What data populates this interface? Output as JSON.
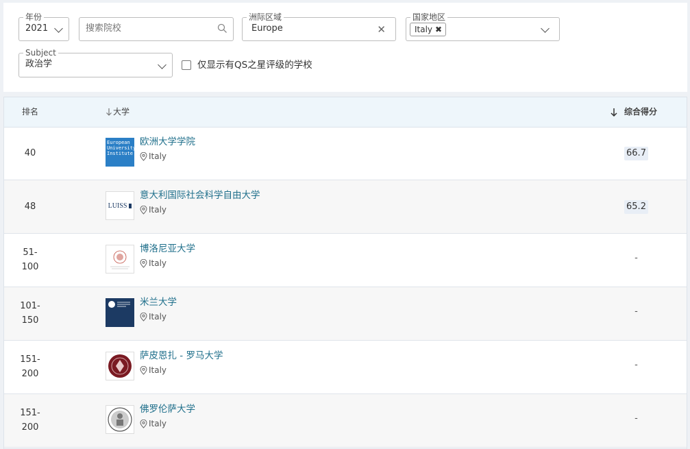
{
  "filters": {
    "year": {
      "legend": "年份",
      "value": "2021"
    },
    "search": {
      "placeholder": "搜索院校"
    },
    "region": {
      "legend": "洲际区域",
      "value": "Europe"
    },
    "country": {
      "legend": "国家地区",
      "tag": "Italy"
    },
    "subject": {
      "legend": "Subject",
      "value": "政治学"
    },
    "qs_stars_only": {
      "label": "仅显示有QS之星评级的学校",
      "checked": false
    }
  },
  "table": {
    "headers": {
      "rank": "排名",
      "university": "大学",
      "score": "综合得分"
    },
    "rows": [
      {
        "rank": [
          "40"
        ],
        "name": "欧洲大学学院",
        "location": "Italy",
        "score": "66.7",
        "logo_text": "European University Institute",
        "logo_color": "#2b7fc6"
      },
      {
        "rank": [
          "48"
        ],
        "name": "意大利国际社会科学自由大学",
        "location": "Italy",
        "score": "65.2",
        "logo_text": "LUISS",
        "logo_color": "#1c3a63"
      },
      {
        "rank": [
          "51-",
          "100"
        ],
        "name": "博洛尼亚大学",
        "location": "Italy",
        "score": "-",
        "logo_color": "#c14b3f"
      },
      {
        "rank": [
          "101-",
          "150"
        ],
        "name": "米兰大学",
        "location": "Italy",
        "score": "-",
        "logo_color": "#1c3a63"
      },
      {
        "rank": [
          "151-",
          "200"
        ],
        "name": "萨皮恩扎 - 罗马大学",
        "location": "Italy",
        "score": "-",
        "logo_color": "#7a1a22"
      },
      {
        "rank": [
          "151-",
          "200"
        ],
        "name": "佛罗伦萨大学",
        "location": "Italy",
        "score": "-",
        "logo_color": "#555555"
      }
    ]
  }
}
